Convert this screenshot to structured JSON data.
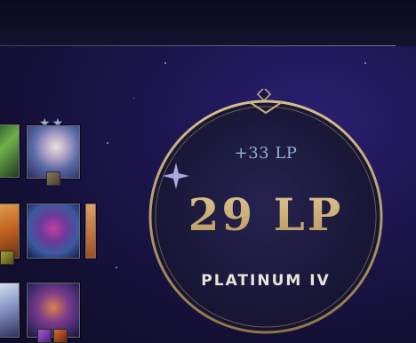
{
  "rank_panel": {
    "lp_gain": "+33 LP",
    "lp_value": "29 LP",
    "rank_name": "PLATINUM IV"
  },
  "champion_board": {
    "top_unit_star_level": 2,
    "star_glyph": "★"
  },
  "colors": {
    "ring_gold": "#b9a170",
    "lp_gold": "#c9ad79",
    "lp_gain_blue": "#8fb0d6",
    "rank_text": "#e8e4dc",
    "background": "#1c1650"
  },
  "icons": [
    "diamond-ornament-icon",
    "four-point-sparkle-icon",
    "star-icon",
    "item-icon"
  ]
}
